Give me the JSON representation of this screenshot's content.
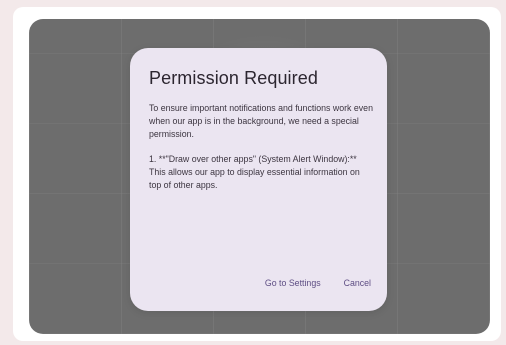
{
  "dialog": {
    "title": "Permission Required",
    "paragraphs": [
      "To ensure important notifications and functions work even when our app is in the background, we need a special permission.",
      "1. **\"Draw over other apps\" (System Alert Window):** This allows our app to display essential information on top of other apps."
    ],
    "actions": {
      "go_to_settings": "Go to Settings",
      "cancel": "Cancel"
    }
  },
  "colors": {
    "page_background": "#f3e9ea",
    "overlay": "#6d6d6d",
    "dialog_background": "#ebe5f1",
    "button_text": "#5e4e84"
  }
}
